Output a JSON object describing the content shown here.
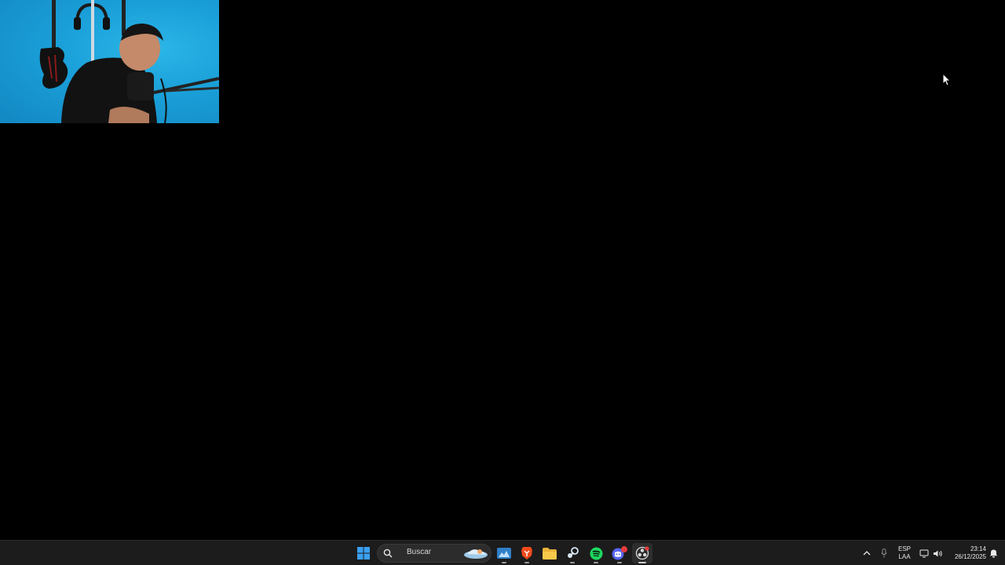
{
  "taskbar": {
    "search": {
      "label": "Buscar"
    },
    "apps": [
      {
        "name": "start",
        "icon": "windows-logo-icon"
      },
      {
        "name": "widgets",
        "icon": "widgets-icon"
      },
      {
        "name": "brave",
        "icon": "brave-icon"
      },
      {
        "name": "file-explorer",
        "icon": "folder-icon"
      },
      {
        "name": "steam",
        "icon": "steam-icon"
      },
      {
        "name": "spotify",
        "icon": "spotify-icon"
      },
      {
        "name": "discord",
        "icon": "discord-icon",
        "badge": "9+"
      },
      {
        "name": "obs",
        "icon": "obs-icon"
      }
    ],
    "tray": {
      "language_line1": "ESP",
      "language_line2": "LAA",
      "time": "23:14",
      "date": "26/12/2025"
    }
  },
  "colors": {
    "desktop": "#000000",
    "taskbar": "#1c1c1c",
    "webcam_wall": "#1a9fd8",
    "accent_blue": "#3aa0f3"
  }
}
